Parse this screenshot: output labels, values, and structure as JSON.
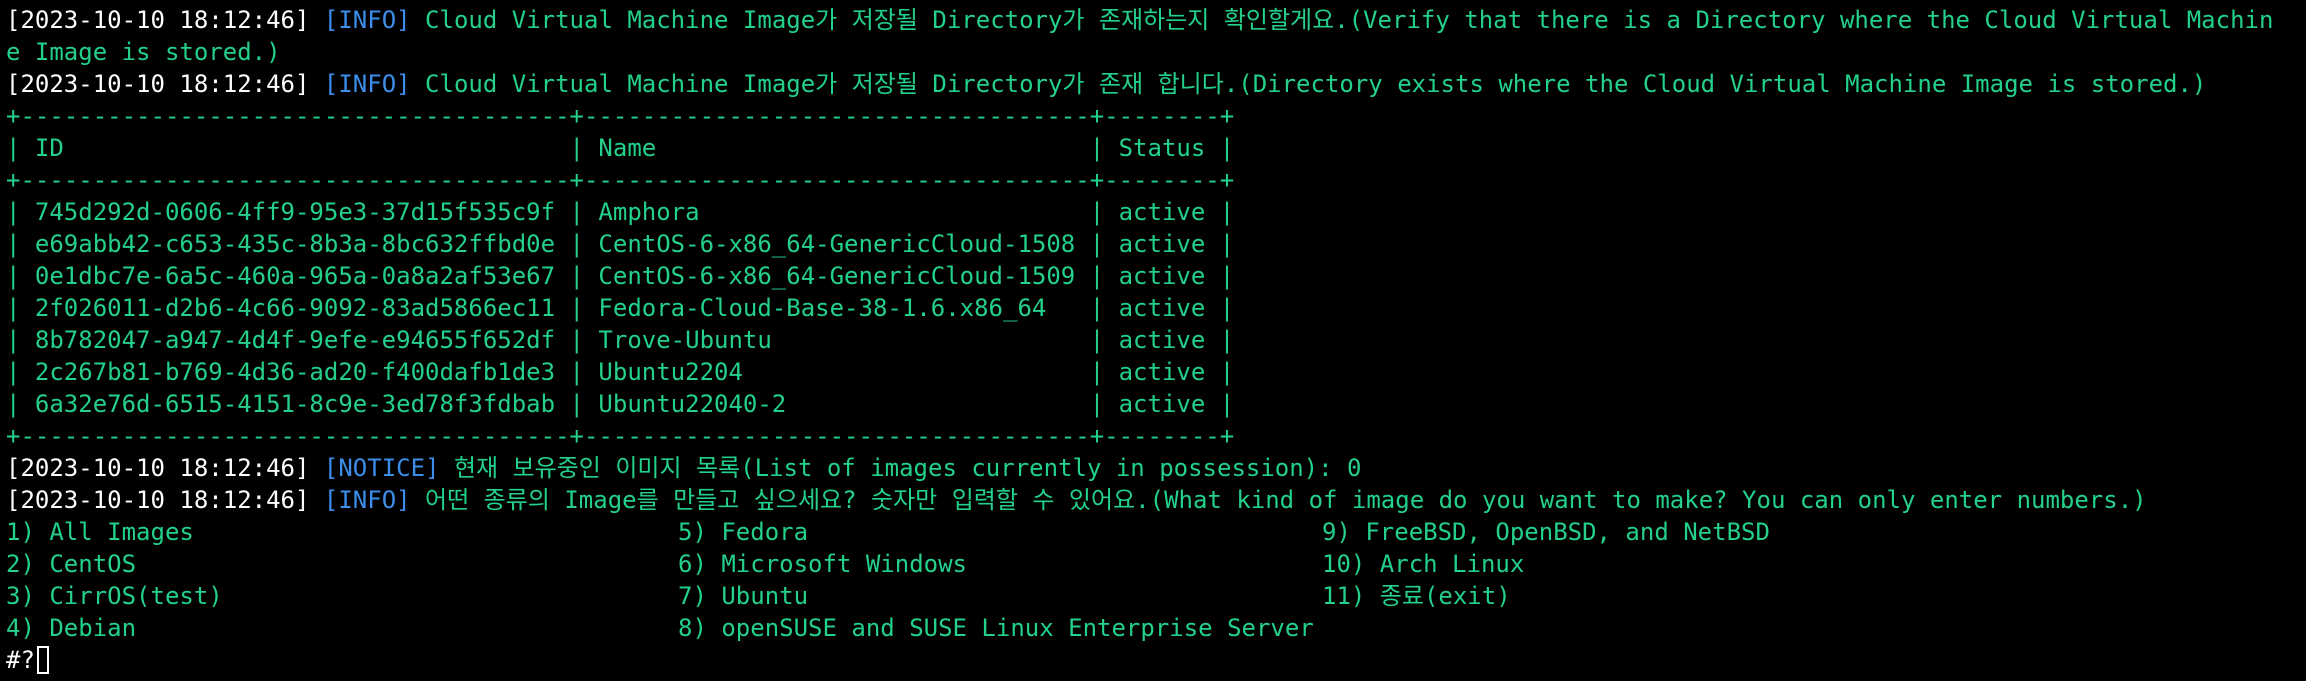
{
  "colors": {
    "background": "#000000",
    "text": "#ffffff",
    "tag_blue": "#3b8eea",
    "message_green": "#23d18b"
  },
  "log": [
    {
      "timestamp": "[2023-10-10 18:12:46]",
      "level": "[INFO]",
      "message": "Cloud Virtual Machine Image가 저장될 Directory가 존재하는지 확인할게요.(Verify that there is a Directory where the Cloud Virtual Machin",
      "continuation": "e Image is stored.)"
    },
    {
      "timestamp": "[2023-10-10 18:12:46]",
      "level": "[INFO]",
      "message": "Cloud Virtual Machine Image가 저장될 Directory가 존재 합니다.(Directory exists where the Cloud Virtual Machine Image is stored.)"
    }
  ],
  "table": {
    "border": "+--------------------------------------+-----------------------------------+--------+",
    "header": "| ID                                   | Name                              | Status |",
    "rows": [
      "| 745d292d-0606-4ff9-95e3-37d15f535c9f | Amphora                           | active |",
      "| e69abb42-c653-435c-8b3a-8bc632ffbd0e | CentOS-6-x86_64-GenericCloud-1508 | active |",
      "| 0e1dbc7e-6a5c-460a-965a-0a8a2af53e67 | CentOS-6-x86_64-GenericCloud-1509 | active |",
      "| 2f026011-d2b6-4c66-9092-83ad5866ec11 | Fedora-Cloud-Base-38-1.6.x86_64   | active |",
      "| 8b782047-a947-4d4f-9efe-e94655f652df | Trove-Ubuntu                      | active |",
      "| 2c267b81-b769-4d36-ad20-f400dafb1de3 | Ubuntu2204                        | active |",
      "| 6a32e76d-6515-4151-8c9e-3ed78f3fdbab | Ubuntu22040-2                     | active |"
    ]
  },
  "notice": {
    "timestamp": "[2023-10-10 18:12:46]",
    "level": "[NOTICE]",
    "message": "현재 보유중인 이미지 목록(List of images currently in possession): 0"
  },
  "question": {
    "timestamp": "[2023-10-10 18:12:46]",
    "level": "[INFO]",
    "message": "어떤 종류의 Image를 만들고 싶으세요? 숫자만 입력할 수 있어요.(What kind of image do you want to make? You can only enter numbers.)"
  },
  "menu": {
    "col1": [
      "1) All Images",
      "2) CentOS",
      "3) CirrOS(test)",
      "4) Debian"
    ],
    "col2": [
      "5) Fedora",
      "6) Microsoft Windows",
      "7) Ubuntu",
      "8) openSUSE and SUSE Linux Enterprise Server"
    ],
    "col3": [
      "9) FreeBSD, OpenBSD, and NetBSD",
      "10) Arch Linux",
      "11) 종료(exit)"
    ]
  },
  "prompt": "#?"
}
